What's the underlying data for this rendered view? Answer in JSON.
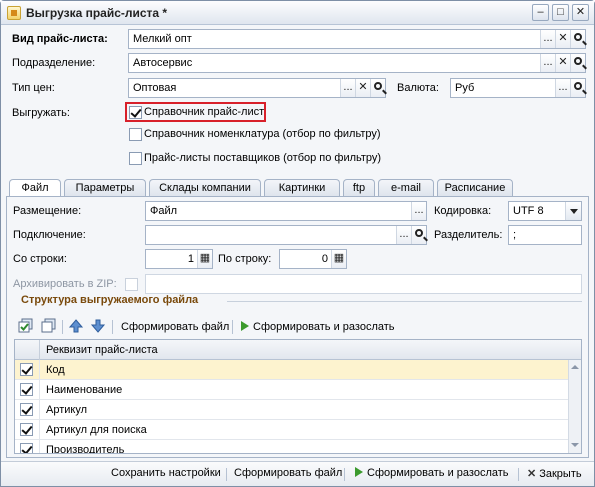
{
  "window": {
    "title": "Выгрузка прайс-листа *"
  },
  "titlebar_buttons": {
    "minimize": "–",
    "maximize": "□",
    "close": "✕"
  },
  "form": {
    "price_list_type": {
      "label": "Вид прайс-листа:",
      "value": "Мелкий опт"
    },
    "division": {
      "label": "Подразделение:",
      "value": "Автосервис"
    },
    "price_type": {
      "label": "Тип цен:",
      "value": "Оптовая"
    },
    "currency": {
      "label": "Валюта:",
      "value": "Руб"
    },
    "export": {
      "label": "Выгружать:",
      "options": [
        {
          "label": "Справочник прайс-лист",
          "checked": true
        },
        {
          "label": "Справочник номенклатура (отбор по фильтру)",
          "checked": false
        },
        {
          "label": "Прайс-листы поставщиков (отбор по фильтру)",
          "checked": false
        }
      ]
    }
  },
  "field_buttons": {
    "select": "...",
    "clear": "✕"
  },
  "tabs": [
    "Файл",
    "Параметры",
    "Склады компании",
    "Картинки",
    "ftp",
    "e-mail",
    "Расписание"
  ],
  "file_tab": {
    "placement": {
      "label": "Размещение:",
      "value": "Файл"
    },
    "encoding": {
      "label": "Кодировка:",
      "value": "UTF 8"
    },
    "connection": {
      "label": "Подключение:",
      "value": ""
    },
    "separator": {
      "label": "Разделитель:",
      "value": ";"
    },
    "from_row": {
      "label": "Со строки:",
      "value": "1"
    },
    "to_row": {
      "label": "По строку:",
      "value": "0"
    },
    "archive": {
      "label": "Архивировать в ZIP:",
      "checked": false
    }
  },
  "structure": {
    "title": "Структура выгружаемого файла",
    "toolbar": {
      "generate_file": "Сформировать файл",
      "generate_and_send": "Сформировать и разослать"
    },
    "column_header": "Реквизит прайс-листа",
    "rows": [
      {
        "label": "Код",
        "checked": true
      },
      {
        "label": "Наименование",
        "checked": true
      },
      {
        "label": "Артикул",
        "checked": true
      },
      {
        "label": "Артикул для поиска",
        "checked": true
      },
      {
        "label": "Производитель",
        "checked": true
      }
    ]
  },
  "bottom_bar": {
    "save_settings": "Сохранить настройки",
    "generate_file": "Сформировать файл",
    "generate_and_send": "Сформировать и разослать",
    "close": "Закрыть"
  }
}
